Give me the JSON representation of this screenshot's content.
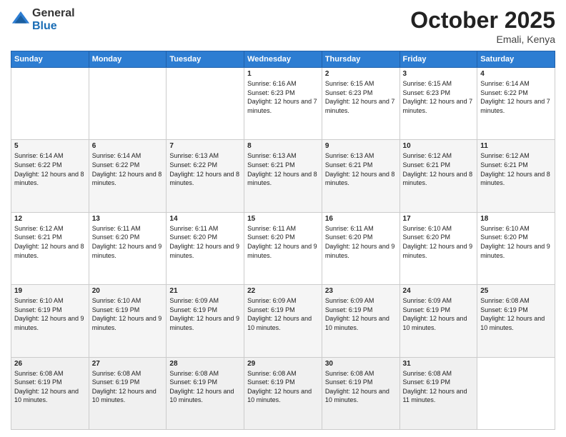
{
  "header": {
    "logo_line1": "General",
    "logo_line2": "Blue",
    "month": "October 2025",
    "location": "Emali, Kenya"
  },
  "weekdays": [
    "Sunday",
    "Monday",
    "Tuesday",
    "Wednesday",
    "Thursday",
    "Friday",
    "Saturday"
  ],
  "weeks": [
    [
      {
        "day": "",
        "sunrise": "",
        "sunset": "",
        "daylight": ""
      },
      {
        "day": "",
        "sunrise": "",
        "sunset": "",
        "daylight": ""
      },
      {
        "day": "",
        "sunrise": "",
        "sunset": "",
        "daylight": ""
      },
      {
        "day": "1",
        "sunrise": "Sunrise: 6:16 AM",
        "sunset": "Sunset: 6:23 PM",
        "daylight": "Daylight: 12 hours and 7 minutes."
      },
      {
        "day": "2",
        "sunrise": "Sunrise: 6:15 AM",
        "sunset": "Sunset: 6:23 PM",
        "daylight": "Daylight: 12 hours and 7 minutes."
      },
      {
        "day": "3",
        "sunrise": "Sunrise: 6:15 AM",
        "sunset": "Sunset: 6:23 PM",
        "daylight": "Daylight: 12 hours and 7 minutes."
      },
      {
        "day": "4",
        "sunrise": "Sunrise: 6:14 AM",
        "sunset": "Sunset: 6:22 PM",
        "daylight": "Daylight: 12 hours and 7 minutes."
      }
    ],
    [
      {
        "day": "5",
        "sunrise": "Sunrise: 6:14 AM",
        "sunset": "Sunset: 6:22 PM",
        "daylight": "Daylight: 12 hours and 8 minutes."
      },
      {
        "day": "6",
        "sunrise": "Sunrise: 6:14 AM",
        "sunset": "Sunset: 6:22 PM",
        "daylight": "Daylight: 12 hours and 8 minutes."
      },
      {
        "day": "7",
        "sunrise": "Sunrise: 6:13 AM",
        "sunset": "Sunset: 6:22 PM",
        "daylight": "Daylight: 12 hours and 8 minutes."
      },
      {
        "day": "8",
        "sunrise": "Sunrise: 6:13 AM",
        "sunset": "Sunset: 6:21 PM",
        "daylight": "Daylight: 12 hours and 8 minutes."
      },
      {
        "day": "9",
        "sunrise": "Sunrise: 6:13 AM",
        "sunset": "Sunset: 6:21 PM",
        "daylight": "Daylight: 12 hours and 8 minutes."
      },
      {
        "day": "10",
        "sunrise": "Sunrise: 6:12 AM",
        "sunset": "Sunset: 6:21 PM",
        "daylight": "Daylight: 12 hours and 8 minutes."
      },
      {
        "day": "11",
        "sunrise": "Sunrise: 6:12 AM",
        "sunset": "Sunset: 6:21 PM",
        "daylight": "Daylight: 12 hours and 8 minutes."
      }
    ],
    [
      {
        "day": "12",
        "sunrise": "Sunrise: 6:12 AM",
        "sunset": "Sunset: 6:21 PM",
        "daylight": "Daylight: 12 hours and 8 minutes."
      },
      {
        "day": "13",
        "sunrise": "Sunrise: 6:11 AM",
        "sunset": "Sunset: 6:20 PM",
        "daylight": "Daylight: 12 hours and 9 minutes."
      },
      {
        "day": "14",
        "sunrise": "Sunrise: 6:11 AM",
        "sunset": "Sunset: 6:20 PM",
        "daylight": "Daylight: 12 hours and 9 minutes."
      },
      {
        "day": "15",
        "sunrise": "Sunrise: 6:11 AM",
        "sunset": "Sunset: 6:20 PM",
        "daylight": "Daylight: 12 hours and 9 minutes."
      },
      {
        "day": "16",
        "sunrise": "Sunrise: 6:11 AM",
        "sunset": "Sunset: 6:20 PM",
        "daylight": "Daylight: 12 hours and 9 minutes."
      },
      {
        "day": "17",
        "sunrise": "Sunrise: 6:10 AM",
        "sunset": "Sunset: 6:20 PM",
        "daylight": "Daylight: 12 hours and 9 minutes."
      },
      {
        "day": "18",
        "sunrise": "Sunrise: 6:10 AM",
        "sunset": "Sunset: 6:20 PM",
        "daylight": "Daylight: 12 hours and 9 minutes."
      }
    ],
    [
      {
        "day": "19",
        "sunrise": "Sunrise: 6:10 AM",
        "sunset": "Sunset: 6:19 PM",
        "daylight": "Daylight: 12 hours and 9 minutes."
      },
      {
        "day": "20",
        "sunrise": "Sunrise: 6:10 AM",
        "sunset": "Sunset: 6:19 PM",
        "daylight": "Daylight: 12 hours and 9 minutes."
      },
      {
        "day": "21",
        "sunrise": "Sunrise: 6:09 AM",
        "sunset": "Sunset: 6:19 PM",
        "daylight": "Daylight: 12 hours and 9 minutes."
      },
      {
        "day": "22",
        "sunrise": "Sunrise: 6:09 AM",
        "sunset": "Sunset: 6:19 PM",
        "daylight": "Daylight: 12 hours and 10 minutes."
      },
      {
        "day": "23",
        "sunrise": "Sunrise: 6:09 AM",
        "sunset": "Sunset: 6:19 PM",
        "daylight": "Daylight: 12 hours and 10 minutes."
      },
      {
        "day": "24",
        "sunrise": "Sunrise: 6:09 AM",
        "sunset": "Sunset: 6:19 PM",
        "daylight": "Daylight: 12 hours and 10 minutes."
      },
      {
        "day": "25",
        "sunrise": "Sunrise: 6:08 AM",
        "sunset": "Sunset: 6:19 PM",
        "daylight": "Daylight: 12 hours and 10 minutes."
      }
    ],
    [
      {
        "day": "26",
        "sunrise": "Sunrise: 6:08 AM",
        "sunset": "Sunset: 6:19 PM",
        "daylight": "Daylight: 12 hours and 10 minutes."
      },
      {
        "day": "27",
        "sunrise": "Sunrise: 6:08 AM",
        "sunset": "Sunset: 6:19 PM",
        "daylight": "Daylight: 12 hours and 10 minutes."
      },
      {
        "day": "28",
        "sunrise": "Sunrise: 6:08 AM",
        "sunset": "Sunset: 6:19 PM",
        "daylight": "Daylight: 12 hours and 10 minutes."
      },
      {
        "day": "29",
        "sunrise": "Sunrise: 6:08 AM",
        "sunset": "Sunset: 6:19 PM",
        "daylight": "Daylight: 12 hours and 10 minutes."
      },
      {
        "day": "30",
        "sunrise": "Sunrise: 6:08 AM",
        "sunset": "Sunset: 6:19 PM",
        "daylight": "Daylight: 12 hours and 10 minutes."
      },
      {
        "day": "31",
        "sunrise": "Sunrise: 6:08 AM",
        "sunset": "Sunset: 6:19 PM",
        "daylight": "Daylight: 12 hours and 11 minutes."
      },
      {
        "day": "",
        "sunrise": "",
        "sunset": "",
        "daylight": ""
      }
    ]
  ]
}
